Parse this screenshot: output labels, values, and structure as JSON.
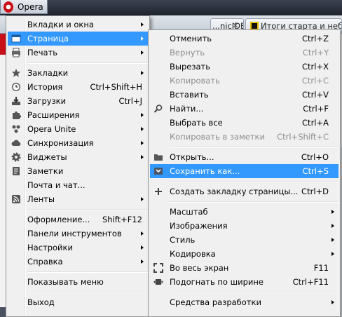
{
  "chrome": {
    "opera_label": "Opera",
    "tabs": [
      {
        "title": "...nicIDEEO - Блог Луз..."
      },
      {
        "title": "Итоги старта и неб..."
      }
    ]
  },
  "main_menu": {
    "items": [
      {
        "label": "Вкладки и окна",
        "shortcut": "",
        "submenu": true
      },
      {
        "label": "Страница",
        "shortcut": "",
        "submenu": true,
        "selected": true
      },
      {
        "label": "Печать",
        "shortcut": "",
        "submenu": true
      },
      {
        "label": "Закладки",
        "shortcut": "",
        "submenu": true
      },
      {
        "label": "История",
        "shortcut": "Ctrl+Shift+H"
      },
      {
        "label": "Загрузки",
        "shortcut": "Ctrl+J"
      },
      {
        "label": "Расширения",
        "shortcut": "",
        "submenu": true
      },
      {
        "label": "Opera Unite",
        "shortcut": "",
        "submenu": true
      },
      {
        "label": "Синхронизация",
        "shortcut": "",
        "submenu": true
      },
      {
        "label": "Виджеты",
        "shortcut": "",
        "submenu": true
      },
      {
        "label": "Заметки",
        "shortcut": ""
      },
      {
        "label": "Почта и чат...",
        "shortcut": ""
      },
      {
        "label": "Ленты",
        "shortcut": "",
        "submenu": true
      },
      {
        "label": "Оформление...",
        "shortcut": "Shift+F12"
      },
      {
        "label": "Панели инструментов",
        "shortcut": "",
        "submenu": true
      },
      {
        "label": "Настройки",
        "shortcut": "",
        "submenu": true
      },
      {
        "label": "Справка",
        "shortcut": "",
        "submenu": true
      },
      {
        "label": "Показывать меню",
        "shortcut": ""
      },
      {
        "label": "Выход",
        "shortcut": ""
      }
    ]
  },
  "page_submenu": {
    "items": [
      {
        "label": "Отменить",
        "shortcut": "Ctrl+Z"
      },
      {
        "label": "Вернуть",
        "shortcut": "Ctrl+Y",
        "disabled": true
      },
      {
        "label": "Вырезать",
        "shortcut": "Ctrl+X"
      },
      {
        "label": "Копировать",
        "shortcut": "Ctrl+C",
        "disabled": true
      },
      {
        "label": "Вставить",
        "shortcut": "Ctrl+V"
      },
      {
        "label": "Найти...",
        "shortcut": "Ctrl+F"
      },
      {
        "label": "Выбрать все",
        "shortcut": "Ctrl+A"
      },
      {
        "label": "Копировать в заметки",
        "shortcut": "Ctrl+Shift+C",
        "disabled": true
      },
      {
        "label": "Открыть...",
        "shortcut": "Ctrl+O"
      },
      {
        "label": "Сохранить как...",
        "shortcut": "Ctrl+S",
        "selected": true
      },
      {
        "label": "Создать закладку страницы...",
        "shortcut": "Ctrl+D"
      },
      {
        "label": "Масштаб",
        "shortcut": "",
        "submenu": true
      },
      {
        "label": "Изображения",
        "shortcut": "",
        "submenu": true
      },
      {
        "label": "Стиль",
        "shortcut": "",
        "submenu": true
      },
      {
        "label": "Кодировка",
        "shortcut": "",
        "submenu": true
      },
      {
        "label": "Во весь экран",
        "shortcut": "F11"
      },
      {
        "label": "Подогнать по ширине",
        "shortcut": "Ctrl+F11"
      },
      {
        "label": "Средства разработки",
        "shortcut": "",
        "submenu": true
      }
    ]
  },
  "colors": {
    "selection": "#3399ff",
    "menu_bg": "#f0f0f0",
    "disabled_text": "#8d8d8d",
    "opera_red": "#cc0f16"
  }
}
